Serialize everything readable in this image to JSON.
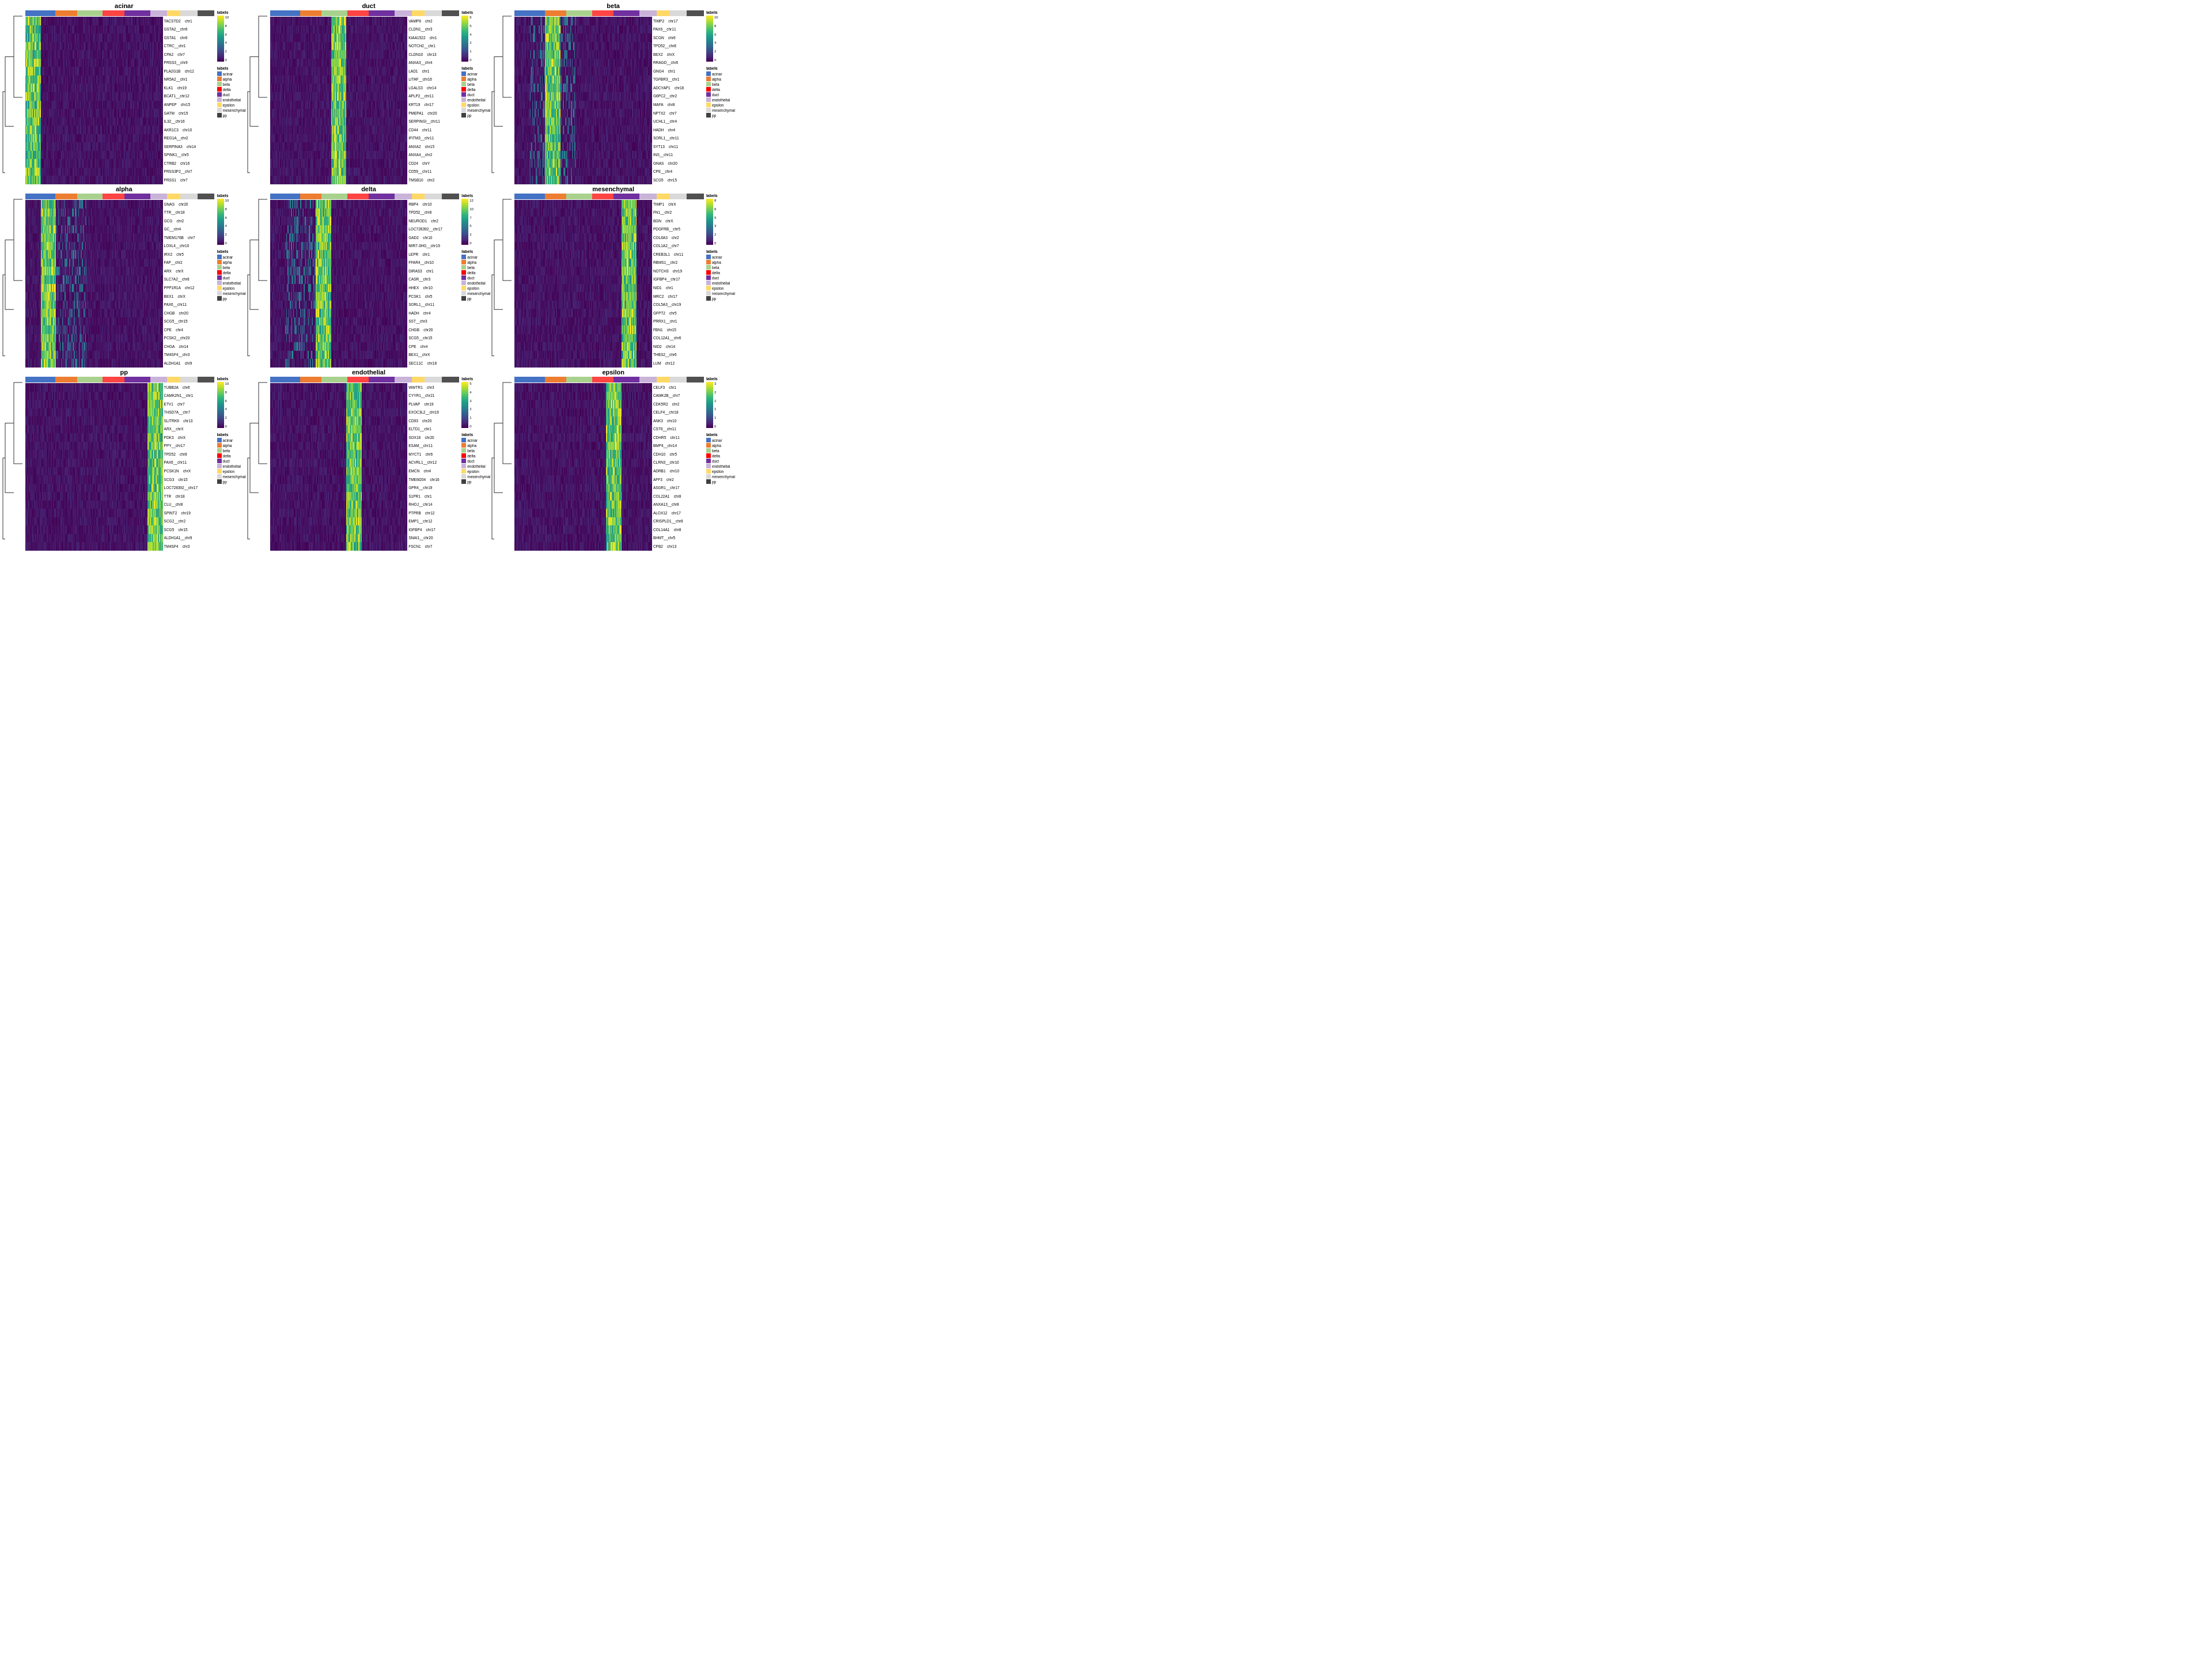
{
  "panels": [
    {
      "id": "acinar",
      "title": "acinar",
      "genes": [
        "TACSTD2__chr1",
        "GSTA2__chr6",
        "GSTA1__chr6",
        "CTRC__chr1",
        "CPA2__chr7",
        "PRSS3__chr9",
        "PLA2G1B__chr12",
        "NR5A2__chr1",
        "KLK1__chr19",
        "BCAT1__chr12",
        "ANPEP__chr15",
        "GATM__chr15",
        "IL32__chr16",
        "AKR1C3__chr10",
        "REG1A__chr2",
        "SERPINA3__chr14",
        "SPINK1__chr5",
        "CTRB2__chr16",
        "PRSS3P2__chr7",
        "PRSS1__chr7"
      ],
      "colorscale_max": 10,
      "colorscale_min": 0
    },
    {
      "id": "duct",
      "title": "duct",
      "genes": [
        "VAMP8__chr2",
        "CLDN1__chr3",
        "KIAA1522__chr1",
        "NOTCH2__chr1",
        "CLDN10__chr13",
        "ANXA3__chr4",
        "LAD1__chr1",
        "LITAF__chr16",
        "LGALS3__chr14",
        "APLP2__chr11",
        "KRT19__chr17",
        "PMEPA1__chr20",
        "SERPINGI__chr11",
        "CD44__chr11",
        "IFITM3__chr11",
        "ANXA2__chr15",
        "ANXA4__chr2",
        "CD24__chrY",
        "CD59__chr11",
        "TMSB10__chr2"
      ],
      "colorscale_max": 6,
      "colorscale_min": 0
    },
    {
      "id": "beta",
      "title": "beta",
      "genes": [
        "TIMP2__chr17",
        "PAX6__chr11",
        "SCGN__chr6",
        "TPD52__chr8",
        "BEX2__chrX",
        "RRAGD__chr6",
        "GNG4__chr1",
        "TGFBR3__chr1",
        "ADCYAP1__chr18",
        "G6PC2__chr2",
        "MAFA__chr8",
        "NPTX2__chr7",
        "UCHL1__chr4",
        "HADH__chr4",
        "SORL1__chr11",
        "SYT13__chr11",
        "INS__chr11",
        "GNAS__chr20",
        "CPE__chr4",
        "SCG5__chr15"
      ],
      "colorscale_max": 10,
      "colorscale_min": 0
    },
    {
      "id": "alpha",
      "title": "alpha",
      "genes": [
        "GNAS__chr20",
        "TTR__chr18",
        "GCG__chr2",
        "GC__chr4",
        "TMEM176B__chr7",
        "LOXL4__chr10",
        "IRX2__chr5",
        "FAP__chr2",
        "ARX__chrX",
        "SLC7A2__chr8",
        "PPP1R1A__chr12",
        "BEX1__chrX",
        "PAX6__chr11",
        "CHGB__chr20",
        "SCG5__chr15",
        "CPE__chr4",
        "PCSK2__chr20",
        "CHGA__chr14",
        "TM4SF4__chr3",
        "ALDH1A1__chr9"
      ],
      "colorscale_max": 10,
      "colorscale_min": 0
    },
    {
      "id": "delta",
      "title": "delta",
      "genes": [
        "RBP4__chr10",
        "TPD52__chr8",
        "NEUROD1__chr2",
        "LOC728392__chr17",
        "GAD2__chr10",
        "MIR7-3HG__chr19",
        "LEPR__chr1",
        "FFAR4__chr10",
        "DIRAS3__chr1",
        "CASR__chr3",
        "HHEX__chr10",
        "PCSK1__chr5",
        "SORL1__chr11",
        "HADH__chr4",
        "SST__chr3",
        "CHGB__chr20",
        "SCG5__chr15",
        "CPE__chr4",
        "BEX1__chrX",
        "SEC11C__chr18"
      ],
      "colorscale_max": 12,
      "colorscale_min": 0
    },
    {
      "id": "mesenchymal",
      "title": "mesenchymal",
      "genes": [
        "TIMP1__chrX",
        "FN1__chr2",
        "BGN__chrX",
        "PDGFRB__chr5",
        "COL6A3__chr2",
        "COL1A2__chr7",
        "CREB3L1__chr11",
        "RBMS1__chr2",
        "NOTCH3__chr19",
        "IGFBP4__chr17",
        "NID1__chr1",
        "MRC2__chr17",
        "COL5A3__chr19",
        "GFPT2__chr5",
        "PRRX1__chr1",
        "FBN1__chr15",
        "COL12A1__chr6",
        "NID2__chr14",
        "THBS2__chr6",
        "LUM__chr12"
      ],
      "colorscale_max": 8,
      "colorscale_min": 0
    },
    {
      "id": "pp",
      "title": "pp",
      "genes": [
        "TUBB2A__chr6",
        "CAMK2N1__chr1",
        "ETV1__chr7",
        "THSD7A__chr7",
        "SLITRK6__chr13",
        "ARX__chrX",
        "PDK3__chrX",
        "PPY__chr17",
        "TPD52__chr8",
        "PAX6__chr11",
        "PCSK1N__chrX",
        "SCG3__chr15",
        "LOC728392__chr17",
        "TTR__chr18",
        "CLU__chr8",
        "SPINT2__chr19",
        "SCG2__chr2",
        "SCG5__chr15",
        "ALDH1A1__chr9",
        "TM4SF4__chr3"
      ],
      "colorscale_max": 10,
      "colorscale_min": 0
    },
    {
      "id": "endothelial",
      "title": "endothelial",
      "genes": [
        "WWTR1__chr3",
        "CYYR1__chr21",
        "PLVAP__chr19",
        "EXOC3L2__chr19",
        "CD93__chr20",
        "ELTD1__chr1",
        "SOX18__chr20",
        "ESAM__chr11",
        "MYCT1__chr6",
        "ACVRL1__chr12",
        "EMCN__chr4",
        "TMEM204__chr16",
        "GPR4__chr19",
        "S1PR1__chr1",
        "RHOJ__chr14",
        "PTPRB__chr12",
        "EMP1__chr12",
        "IGFBP4__chr17",
        "SNAI1__chr20",
        "FSCN1__chr7"
      ],
      "colorscale_max": 5,
      "colorscale_min": 0
    },
    {
      "id": "epsilon",
      "title": "epsilon",
      "genes": [
        "CELF3__chr1",
        "CAMK2B__chr7",
        "CDK5R2__chr2",
        "CELF4__chr18",
        "ANK3__chr10",
        "CST6__chr11",
        "CDHR5__chr11",
        "BMP4__chr14",
        "CDH10__chr5",
        "CLRN3__chr10",
        "ADRB1__chr10",
        "AFF3__chr2",
        "ASGR1__chr17",
        "COL22A1__chr8",
        "ANXA13__chr8",
        "ALOX12__chr17",
        "CRISPLD1__chr8",
        "COL14A1__chr8",
        "BHMT__chr5",
        "CPB2__chr13"
      ],
      "colorscale_max": 3,
      "colorscale_min": 0
    }
  ],
  "legend": {
    "title": "labels",
    "items": [
      {
        "label": "acinar",
        "color": "#4472C4"
      },
      {
        "label": "alpha",
        "color": "#ED7D31"
      },
      {
        "label": "beta",
        "color": "#A9D18E"
      },
      {
        "label": "delta",
        "color": "#FF0000"
      },
      {
        "label": "duct",
        "color": "#7030A0"
      },
      {
        "label": "endothelial",
        "color": "#C9B3D9"
      },
      {
        "label": "epsilon",
        "color": "#FFD966"
      },
      {
        "label": "mesenchymal",
        "color": "#D9D9D9"
      },
      {
        "label": "pp",
        "color": "#404040"
      }
    ]
  },
  "colorbar_label": "labels"
}
